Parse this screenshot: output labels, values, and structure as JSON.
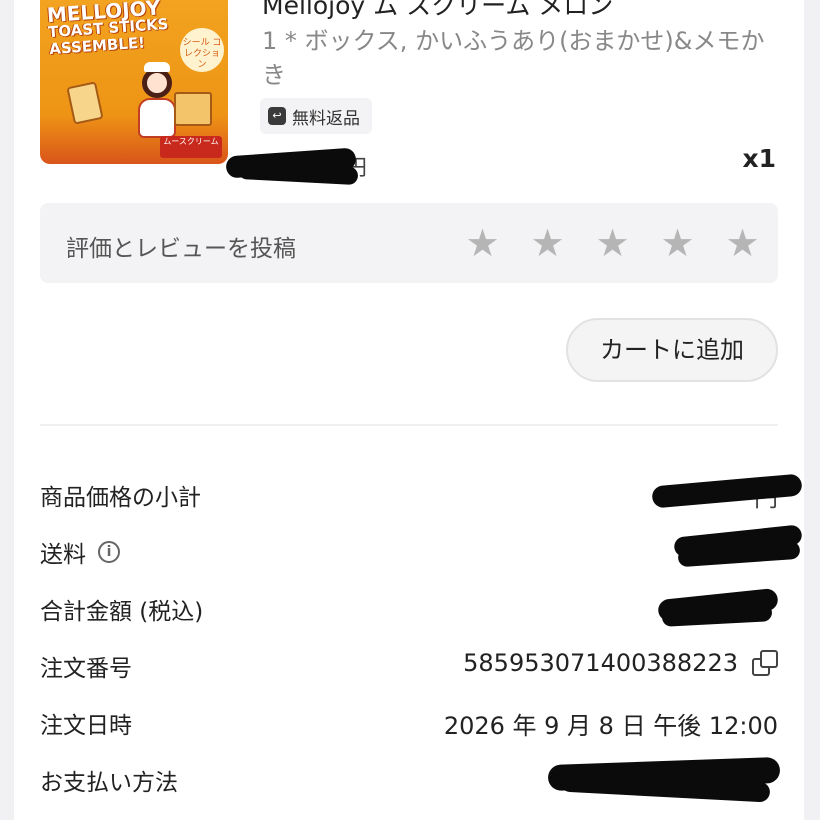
{
  "product": {
    "name": "Mellojoy ム スクリーム メロン",
    "variant": "1 * ボックス, かいふうあり(おまかせ)&メモかき",
    "image_title_line1": "MELLOJOY",
    "image_title_line2": "TOAST STICKS",
    "image_title_line3": "ASSEMBLE!",
    "image_badge": "シール コレクション",
    "image_footer": "ムースクリーム",
    "free_return_label": "無料返品",
    "price_fragment": "円",
    "quantity": "x1"
  },
  "review": {
    "label": "評価とレビューを投稿",
    "star_count": 5,
    "star_glyph": "★"
  },
  "cart_button_label": "カートに追加",
  "summary": {
    "subtotal_label": "商品価格の小計",
    "subtotal_value_fragment": "円",
    "shipping_label": "送料",
    "tax_total_label": "合計金額 (税込)",
    "order_number_label": "注文番号",
    "order_number_value": "585953071400388223",
    "order_date_label": "注文日時",
    "order_date_value": "2026 年 9 月 8 日 午後 12:00",
    "payment_label": "お支払い方法"
  },
  "icons": {
    "info": "info-icon",
    "copy": "copy-icon",
    "return": "return-icon",
    "star": "star-icon"
  },
  "colors": {
    "star_inactive": "#b5b5b5",
    "panel_bg": "#f3f3f5",
    "text_muted": "#888888"
  }
}
